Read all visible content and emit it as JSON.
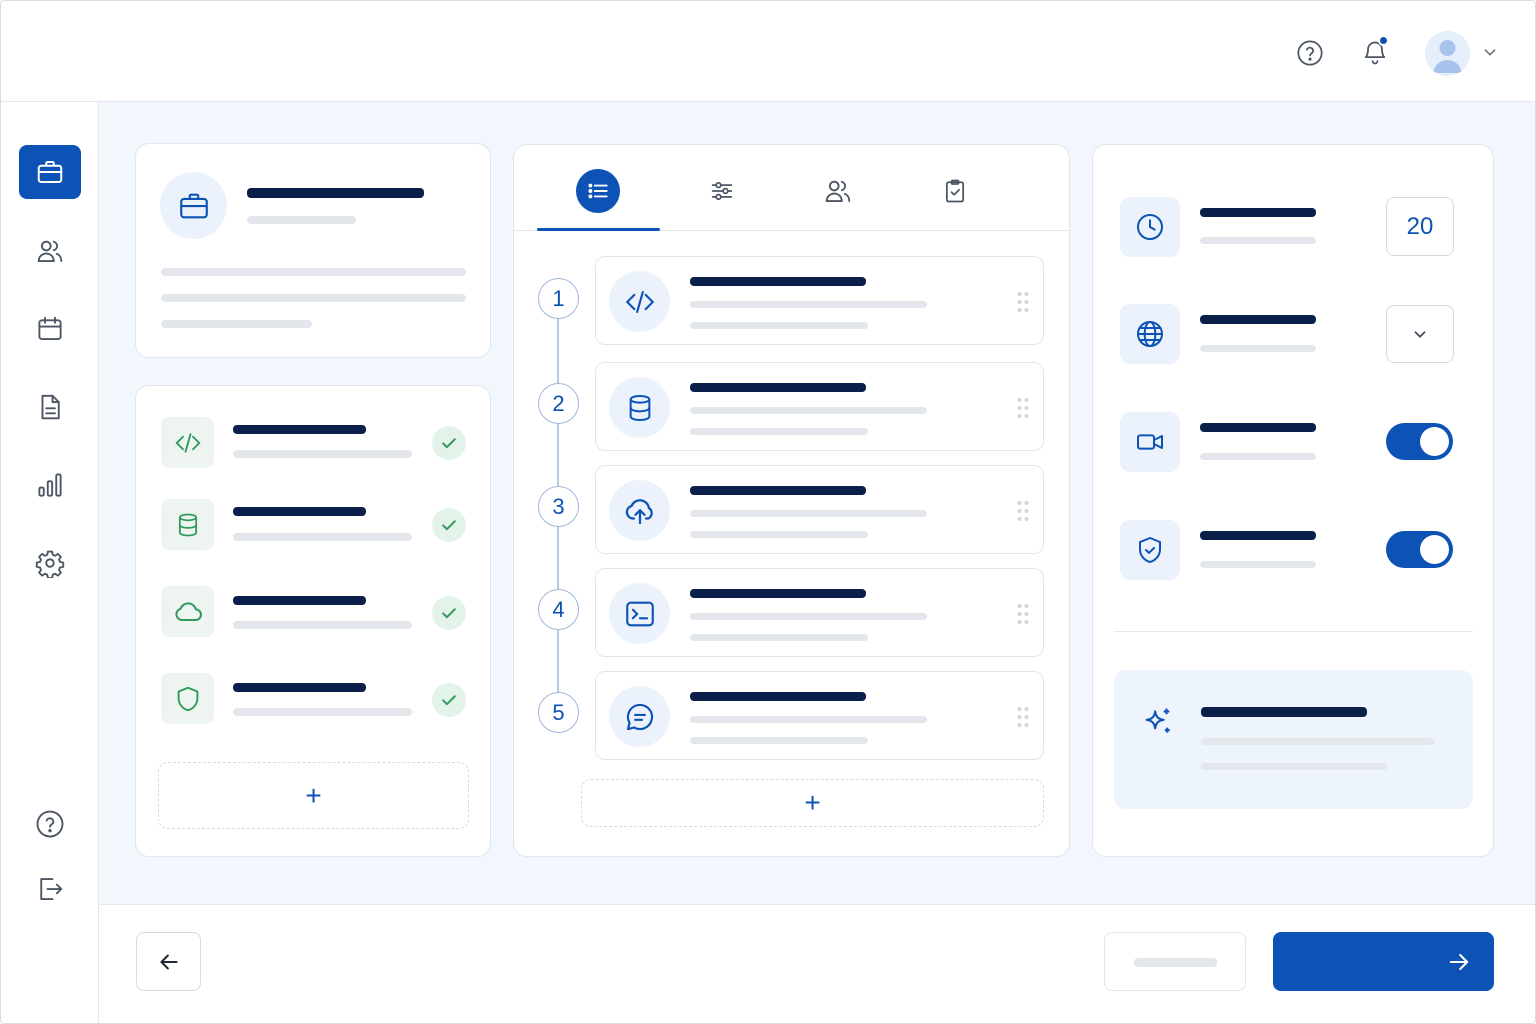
{
  "header": {
    "help_icon": "question-circle-icon",
    "notification_icon": "bell-icon",
    "notification_badge": true,
    "avatar_icon": "user-avatar-icon",
    "menu_icon": "chevron-down-icon"
  },
  "sidebar": {
    "items": [
      {
        "icon": "briefcase-icon",
        "active": true
      },
      {
        "icon": "users-icon",
        "active": false
      },
      {
        "icon": "calendar-icon",
        "active": false
      },
      {
        "icon": "document-icon",
        "active": false
      },
      {
        "icon": "bar-chart-icon",
        "active": false
      },
      {
        "icon": "gear-icon",
        "active": false
      }
    ],
    "bottom_items": [
      {
        "icon": "help-icon"
      },
      {
        "icon": "logout-icon"
      }
    ]
  },
  "project_card": {
    "icon": "briefcase-icon"
  },
  "services_list": {
    "items": [
      {
        "icon": "code-icon",
        "status": "check"
      },
      {
        "icon": "database-icon",
        "status": "check"
      },
      {
        "icon": "cloud-icon",
        "status": "check"
      },
      {
        "icon": "shield-icon",
        "status": "check"
      }
    ],
    "add_label": "+"
  },
  "pipeline": {
    "tabs": [
      {
        "icon": "list-icon",
        "active": true
      },
      {
        "icon": "sliders-icon",
        "active": false
      },
      {
        "icon": "users-icon",
        "active": false
      },
      {
        "icon": "clipboard-check-icon",
        "active": false
      }
    ],
    "steps": [
      {
        "number": "1",
        "icon": "code-icon"
      },
      {
        "number": "2",
        "icon": "database-icon"
      },
      {
        "number": "3",
        "icon": "cloud-upload-icon"
      },
      {
        "number": "4",
        "icon": "terminal-icon"
      },
      {
        "number": "5",
        "icon": "chat-icon"
      }
    ],
    "add_label": "+"
  },
  "settings": {
    "rows": [
      {
        "icon": "clock-icon",
        "control": "number",
        "value": "20"
      },
      {
        "icon": "globe-icon",
        "control": "select"
      },
      {
        "icon": "video-icon",
        "control": "toggle",
        "on": true
      },
      {
        "icon": "shield-check-icon",
        "control": "toggle",
        "on": true
      }
    ],
    "ai_panel": {
      "icon": "sparkles-icon"
    }
  },
  "footer": {
    "back_icon": "arrow-left-icon",
    "next_icon": "arrow-right-icon"
  },
  "colors": {
    "primary": "#0d52b5",
    "dark_text": "#0b1f4b",
    "success": "#2f9a5c",
    "success_bg": "#e4f3ea",
    "icon_bg": "#ebf2fc",
    "page_bg": "#f2f7fd"
  }
}
